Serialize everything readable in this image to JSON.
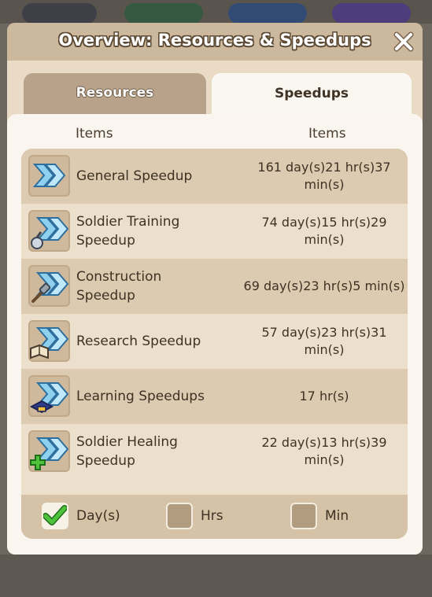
{
  "header": {
    "title": "Overview: Resources & Speedups"
  },
  "tabs": [
    {
      "label": "Resources",
      "active": false
    },
    {
      "label": "Speedups",
      "active": true
    }
  ],
  "columns": {
    "left": "Items",
    "right": "Items"
  },
  "items": [
    {
      "icon": "general-speedup-icon",
      "name": "General Speedup",
      "time": "161 day(s)21 hr(s)37 min(s)"
    },
    {
      "icon": "soldier-training-speedup-icon",
      "name": "Soldier Training Speedup",
      "time": "74 day(s)15 hr(s)29 min(s)"
    },
    {
      "icon": "construction-speedup-icon",
      "name": "Construction Speedup",
      "time": "69 day(s)23 hr(s)5 min(s)"
    },
    {
      "icon": "research-speedup-icon",
      "name": "Research Speedup",
      "time": "57 day(s)23 hr(s)31 min(s)"
    },
    {
      "icon": "learning-speedup-icon",
      "name": "Learning Speedups",
      "time": "17 hr(s)"
    },
    {
      "icon": "soldier-healing-speedup-icon",
      "name": "Soldier Healing Speedup",
      "time": "22 day(s)13 hr(s)39 min(s)"
    }
  ],
  "filters": [
    {
      "label": "Day(s)",
      "checked": true
    },
    {
      "label": "Hrs",
      "checked": false
    },
    {
      "label": "Min",
      "checked": false
    }
  ],
  "colors": {
    "accent_green": "#4fc23c",
    "title_bar": "#ccb89d",
    "panel": "#faf6ef"
  }
}
